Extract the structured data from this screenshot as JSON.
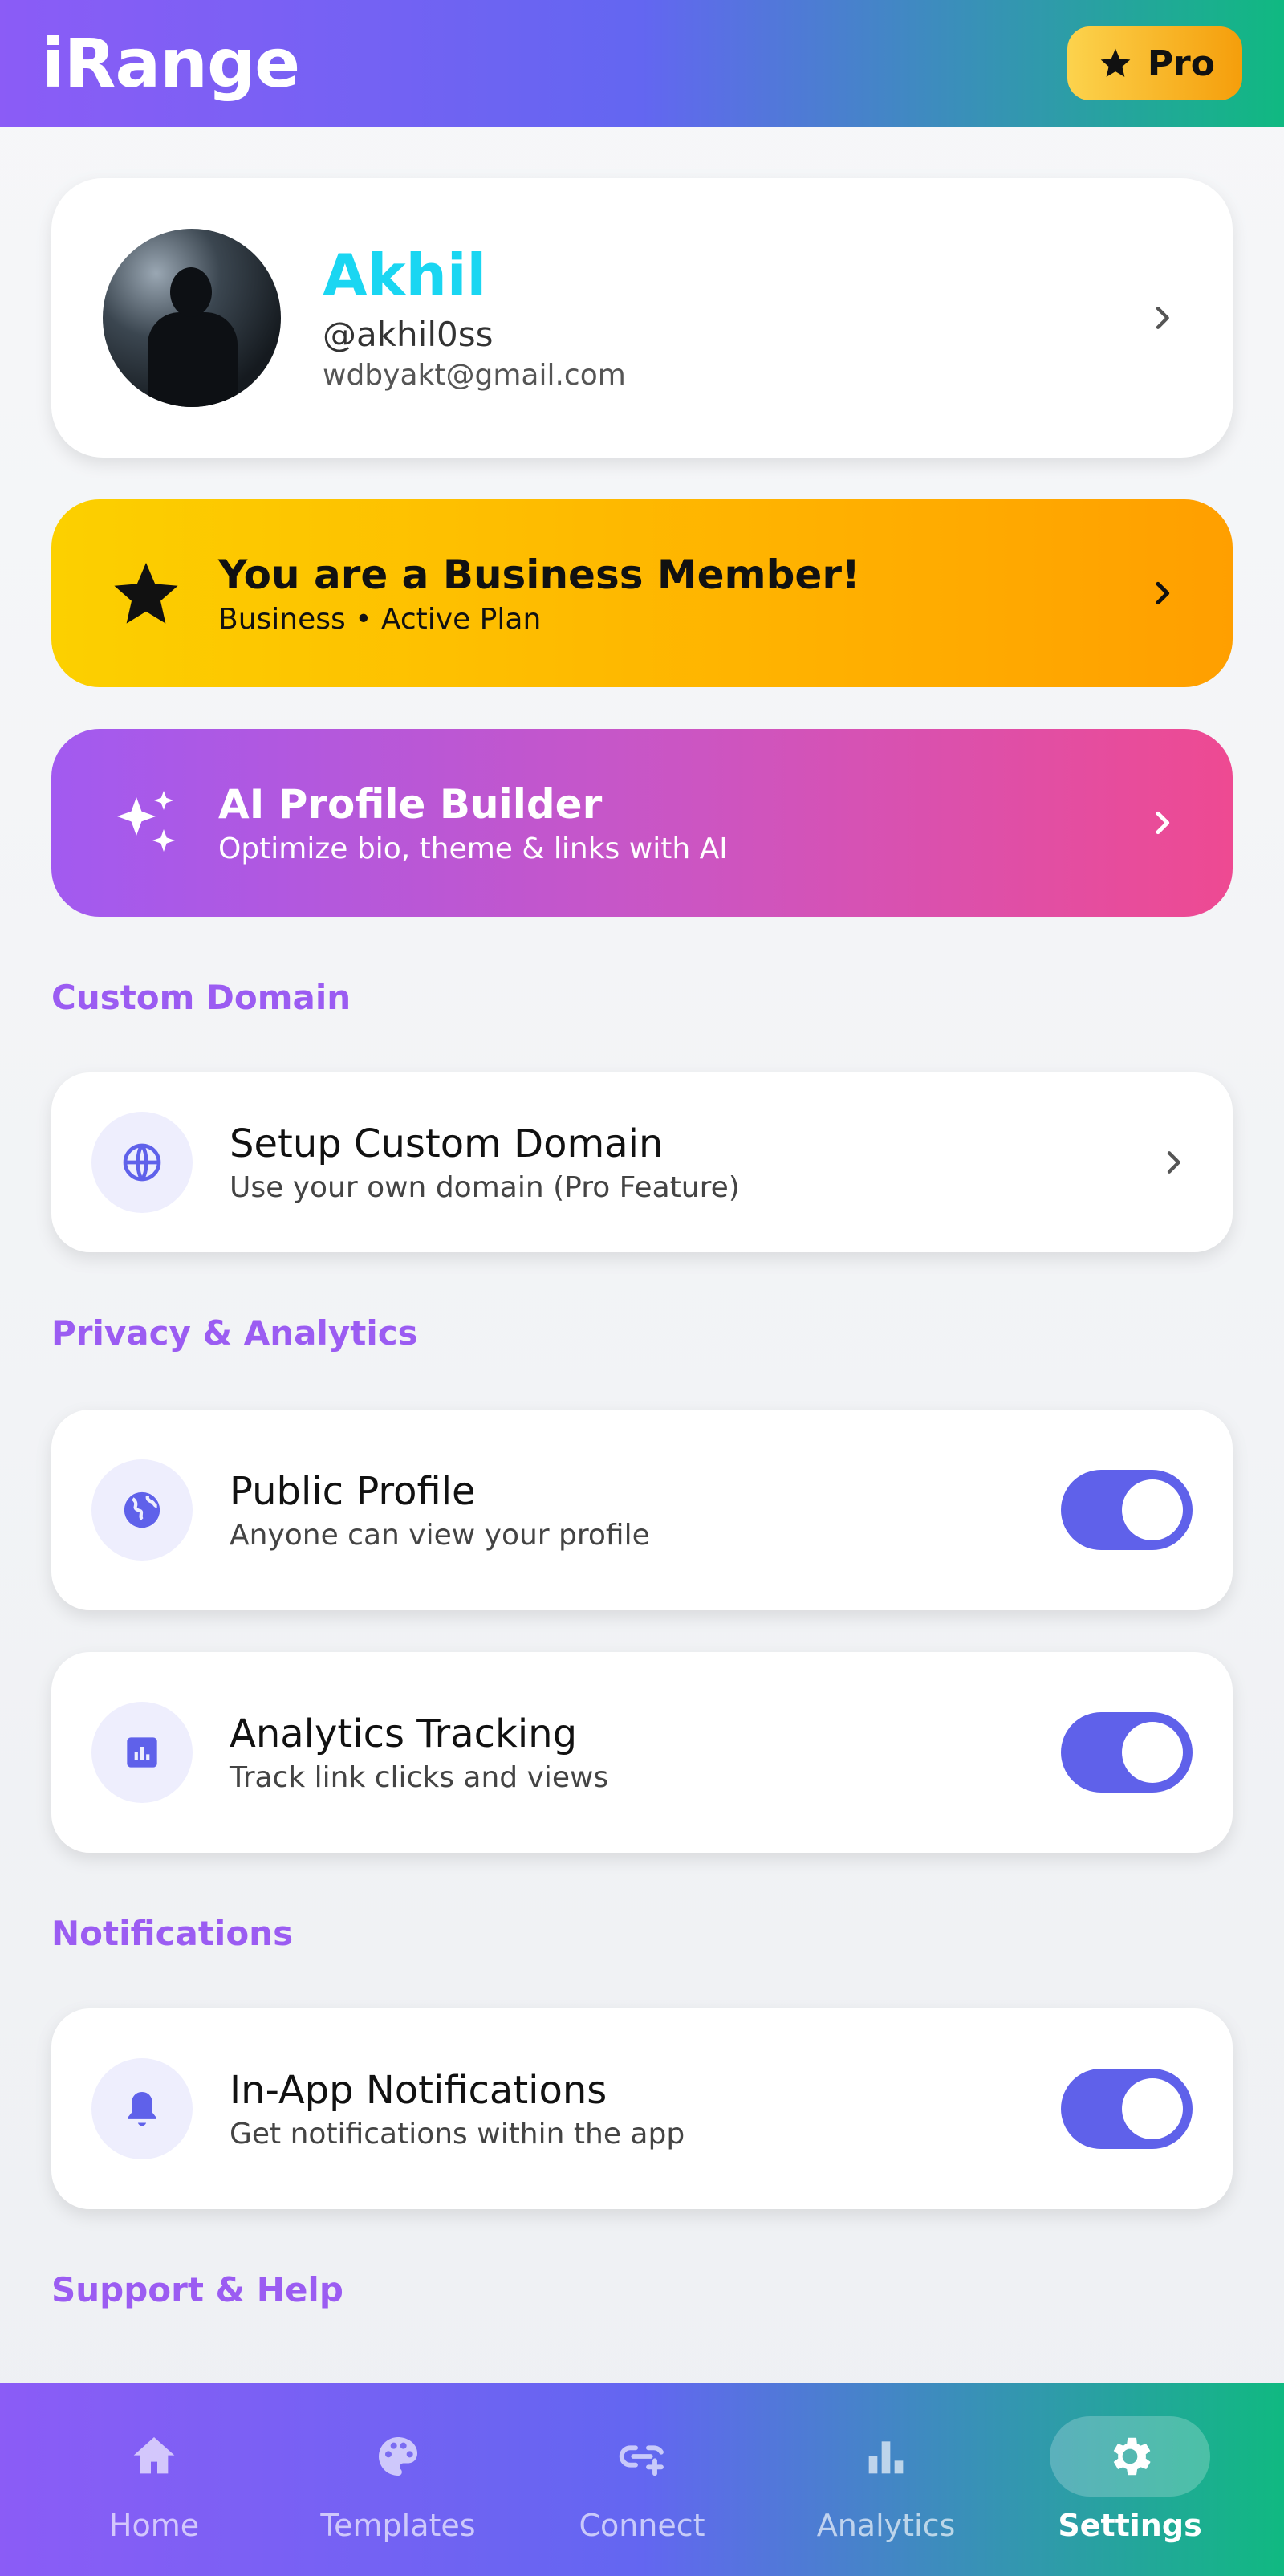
{
  "header": {
    "app_title": "iRange",
    "pro_label": "Pro"
  },
  "profile": {
    "name": "Akhil",
    "handle": "@akhil0ss",
    "email": "wdbyakt@gmail.com"
  },
  "business_banner": {
    "title": "You are a Business Member!",
    "subtitle": "Business • Active Plan"
  },
  "ai_banner": {
    "title": "AI Profile Builder",
    "subtitle": "Optimize bio, theme & links with AI"
  },
  "sections": {
    "custom_domain": "Custom Domain",
    "privacy": "Privacy & Analytics",
    "notifications": "Notifications",
    "support": "Support & Help"
  },
  "settings": {
    "custom_domain": {
      "title": "Setup Custom Domain",
      "subtitle": "Use your own domain (Pro Feature)"
    },
    "public_profile": {
      "title": "Public Profile",
      "subtitle": "Anyone can view your profile",
      "enabled": true
    },
    "analytics_tracking": {
      "title": "Analytics Tracking",
      "subtitle": "Track link clicks and views",
      "enabled": true
    },
    "in_app_notifications": {
      "title": "In-App Notifications",
      "subtitle": "Get notifications within the app",
      "enabled": true
    }
  },
  "nav": {
    "items": [
      {
        "label": "Home",
        "icon": "home-icon"
      },
      {
        "label": "Templates",
        "icon": "palette-icon"
      },
      {
        "label": "Connect",
        "icon": "link-add-icon"
      },
      {
        "label": "Analytics",
        "icon": "bar-chart-icon"
      },
      {
        "label": "Settings",
        "icon": "gear-icon",
        "active": true
      }
    ]
  },
  "colors": {
    "accent": "#6366f1",
    "section_title": "#9b5cf2",
    "name": "#1ad6f2",
    "toggle_on": "#5f61ea"
  }
}
